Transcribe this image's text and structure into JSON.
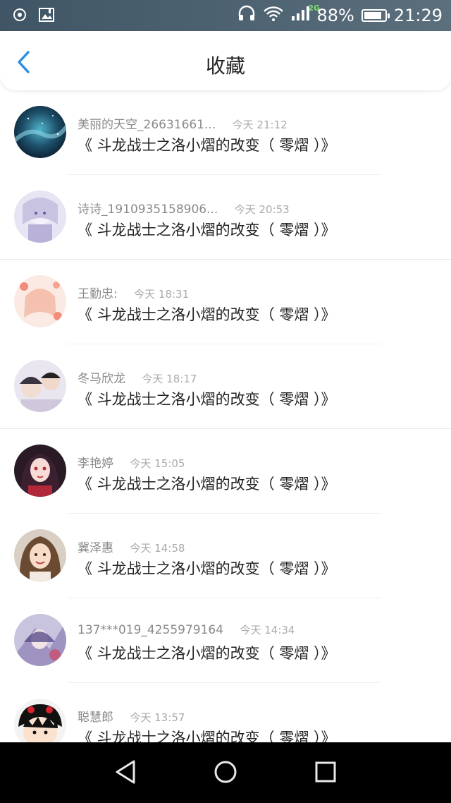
{
  "status_bar": {
    "network": "2G",
    "battery": "88%",
    "battery_level": 0.88,
    "time": "21:29",
    "icons": [
      "location-icon",
      "image-alert-icon",
      "headphones-icon",
      "wifi-icon",
      "signal-icon",
      "battery-icon"
    ]
  },
  "header": {
    "title": "收藏",
    "back_icon": "chevron-left-icon"
  },
  "favorites": [
    {
      "name": "美丽的天空_26631661...",
      "time": "今天 21:12",
      "title": "《 斗龙战士之洛小熠的改变（ 零熠 ）》"
    },
    {
      "name": "诗诗_1910935158906...",
      "time": "今天 20:53",
      "title": "《 斗龙战士之洛小熠的改变（ 零熠 ）》"
    },
    {
      "name": "王勤忠:",
      "time": "今天 18:31",
      "title": "《 斗龙战士之洛小熠的改变（ 零熠 ）》"
    },
    {
      "name": "冬马欣龙",
      "time": "今天 18:17",
      "title": "《 斗龙战士之洛小熠的改变（ 零熠 ）》"
    },
    {
      "name": "李艳婷",
      "time": "今天 15:05",
      "title": "《 斗龙战士之洛小熠的改变（ 零熠 ）》"
    },
    {
      "name": "冀泽惠",
      "time": "今天 14:58",
      "title": "《 斗龙战士之洛小熠的改变（ 零熠 ）》"
    },
    {
      "name": "137***019_4255979164",
      "time": "今天 14:34",
      "title": "《 斗龙战士之洛小熠的改变（ 零熠 ）》"
    },
    {
      "name": "聪慧郎",
      "time": "今天 13:57",
      "title": "《 斗龙战士之洛小熠的改变（ 零熠 ）》"
    }
  ],
  "nav_bar": {
    "icons": [
      "back-triangle-icon",
      "home-circle-icon",
      "recents-square-icon"
    ]
  },
  "colors": {
    "accent": "#2a8de0",
    "status_bar": "#46596a",
    "title_text": "#222222",
    "meta_text": "#9a9a9a"
  }
}
